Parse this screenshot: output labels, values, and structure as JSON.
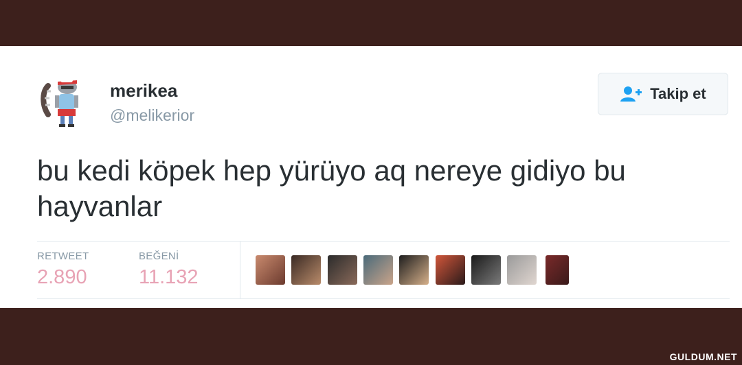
{
  "tweet": {
    "display_name": "merikea",
    "handle": "@melikerior",
    "follow_label": "Takip et",
    "text": "bu kedi köpek hep yürüyo aq nereye gidiyo bu hayvanlar",
    "stats": {
      "retweet_label": "RETWEET",
      "retweet_count": "2.890",
      "like_label": "BEĞENİ",
      "like_count": "11.132"
    },
    "liker_count": 9
  },
  "watermark": "GULDUM.NET",
  "colors": {
    "background": "#3d201c",
    "card": "#ffffff",
    "counts": "#e8a3b5",
    "follow_icon": "#1da1f2"
  }
}
